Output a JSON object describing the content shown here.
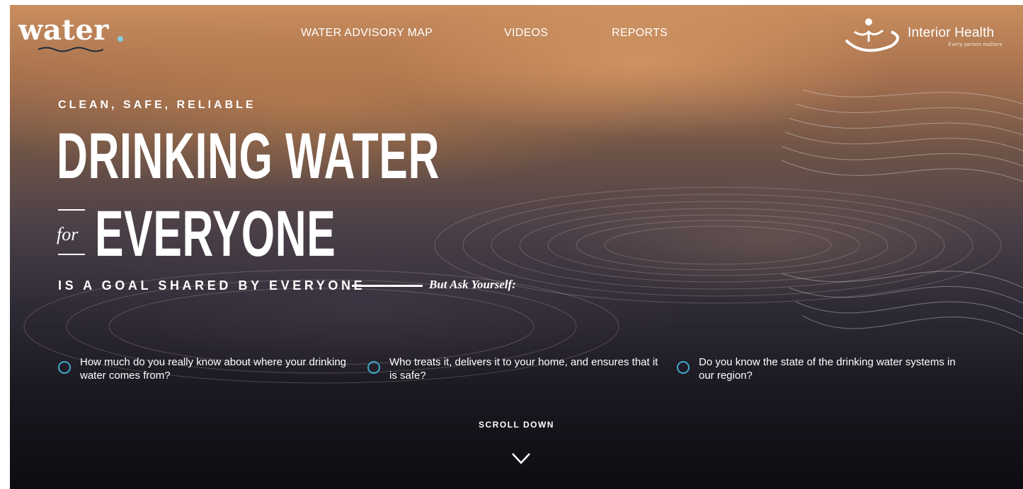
{
  "brand": {
    "logo_text": "water",
    "partner_name": "Interior Health",
    "partner_tagline": "Every person matters"
  },
  "nav": {
    "items": [
      {
        "label": "WATER ADVISORY MAP"
      },
      {
        "label": "VIDEOS"
      },
      {
        "label": "REPORTS"
      }
    ]
  },
  "hero": {
    "eyebrow": "CLEAN, SAFE, RELIABLE",
    "headline_line1": "DRINKING WATER",
    "headline_for": "for",
    "headline_line2": "EVERYONE",
    "subline": "IS A GOAL SHARED BY EVERYONE",
    "ask": "But Ask Yourself:"
  },
  "questions": [
    {
      "text": "How much do you really know about where your drinking water comes from?"
    },
    {
      "text": "Who treats it, delivers it to your home, and ensures that it is safe?"
    },
    {
      "text": "Do you know the state of the drinking water systems in our region?"
    }
  ],
  "scroll": {
    "label": "SCROLL DOWN"
  },
  "colors": {
    "accent": "#3fa9c9",
    "logo_dot": "#7fd0e0",
    "text": "#ffffff"
  },
  "icons": {
    "scroll": "chevron-down-icon",
    "question_marker": "circle-icon",
    "partner_logo": "interior-health-logo"
  }
}
